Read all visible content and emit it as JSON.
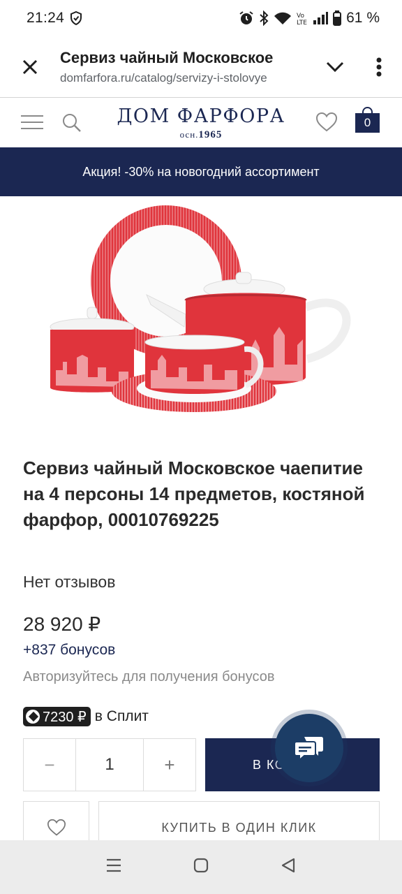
{
  "status_bar": {
    "time": "21:24",
    "battery": "61 %"
  },
  "tab": {
    "title": "Сервиз чайный Московское",
    "url": "domfarfora.ru/catalog/servizy-i-stolovye"
  },
  "site": {
    "logo": "ДОМ ФАРФОРА",
    "logo_sub_prefix": "осн.",
    "logo_sub_year": "1965",
    "cart_count": "0",
    "promo": "Акция! -30% на новогодний ассортимент"
  },
  "product": {
    "title": "Сервиз чайный Московское чаепитие на 4 персоны 14 предметов, костяной фарфор, 00010769225",
    "reviews": "Нет отзывов",
    "price": "28 920 ₽",
    "bonus": "+837 бонусов",
    "auth_note": "Авторизуйтесь для получения бонусов",
    "split_amount": "7230 ₽",
    "split_label": "в Сплит",
    "quantity": "1",
    "minus": "−",
    "plus": "+",
    "add_to_cart": "В КОРЗИНУ",
    "buy_one_click": "КУПИТЬ В ОДИН КЛИК"
  },
  "colors": {
    "brand_navy": "#1b2752",
    "product_red": "#e0343c"
  }
}
